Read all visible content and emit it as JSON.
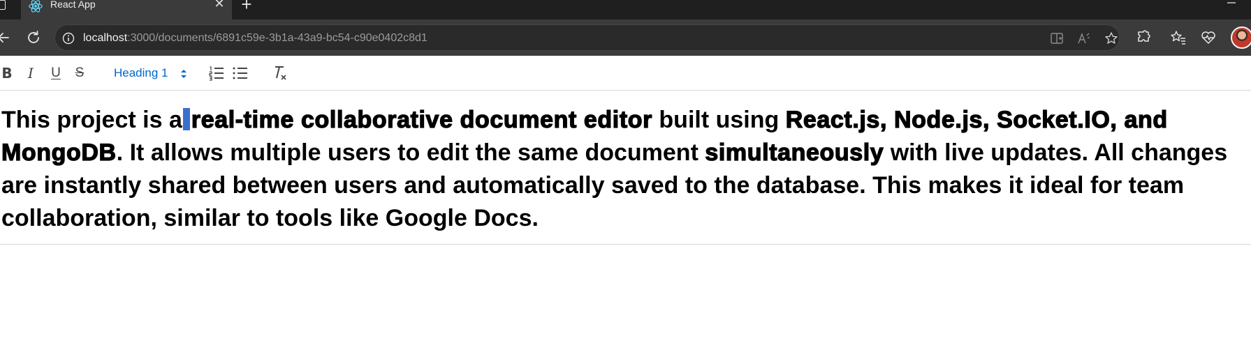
{
  "browser": {
    "tab_title": "React App",
    "tab_close_glyph": "✕",
    "new_tab_glyph": "+",
    "url_host": "localhost",
    "url_rest": ":3000/documents/6891c59e-3b1a-43a9-bc54-c90e0402c8d1",
    "icons": [
      "react-icon",
      "back-icon",
      "refresh-icon",
      "site-info-icon",
      "split-screen-icon",
      "read-aloud-icon",
      "favorite-star-icon",
      "extensions-icon",
      "favorites-icon",
      "browser-essentials-icon",
      "profile-avatar",
      "minimize-icon"
    ]
  },
  "toolbar": {
    "bold_label": "B",
    "italic_label": "I",
    "underline_label": "U",
    "strike_label": "S",
    "header_value": "Heading 1",
    "clean_label": "T"
  },
  "document": {
    "seg1": "This project is a",
    "seg2": "real-time collaborative document editor",
    "seg3": " built using ",
    "seg4": "React.js, Node.js, Socket.IO, and MongoDB",
    "seg5": ". It allows multiple users to edit the same document ",
    "seg6": "simultaneously",
    "seg7": " with live updates. All changes are instantly shared between users and automatically saved to the database. This makes it ideal for team collaboration, similar to tools like Google Docs."
  },
  "colors": {
    "browser_dark": "#1f1f1f",
    "browser_chrome": "#3b3b3b",
    "accent_link": "#0066cc",
    "selection": "#3a6fcf"
  }
}
